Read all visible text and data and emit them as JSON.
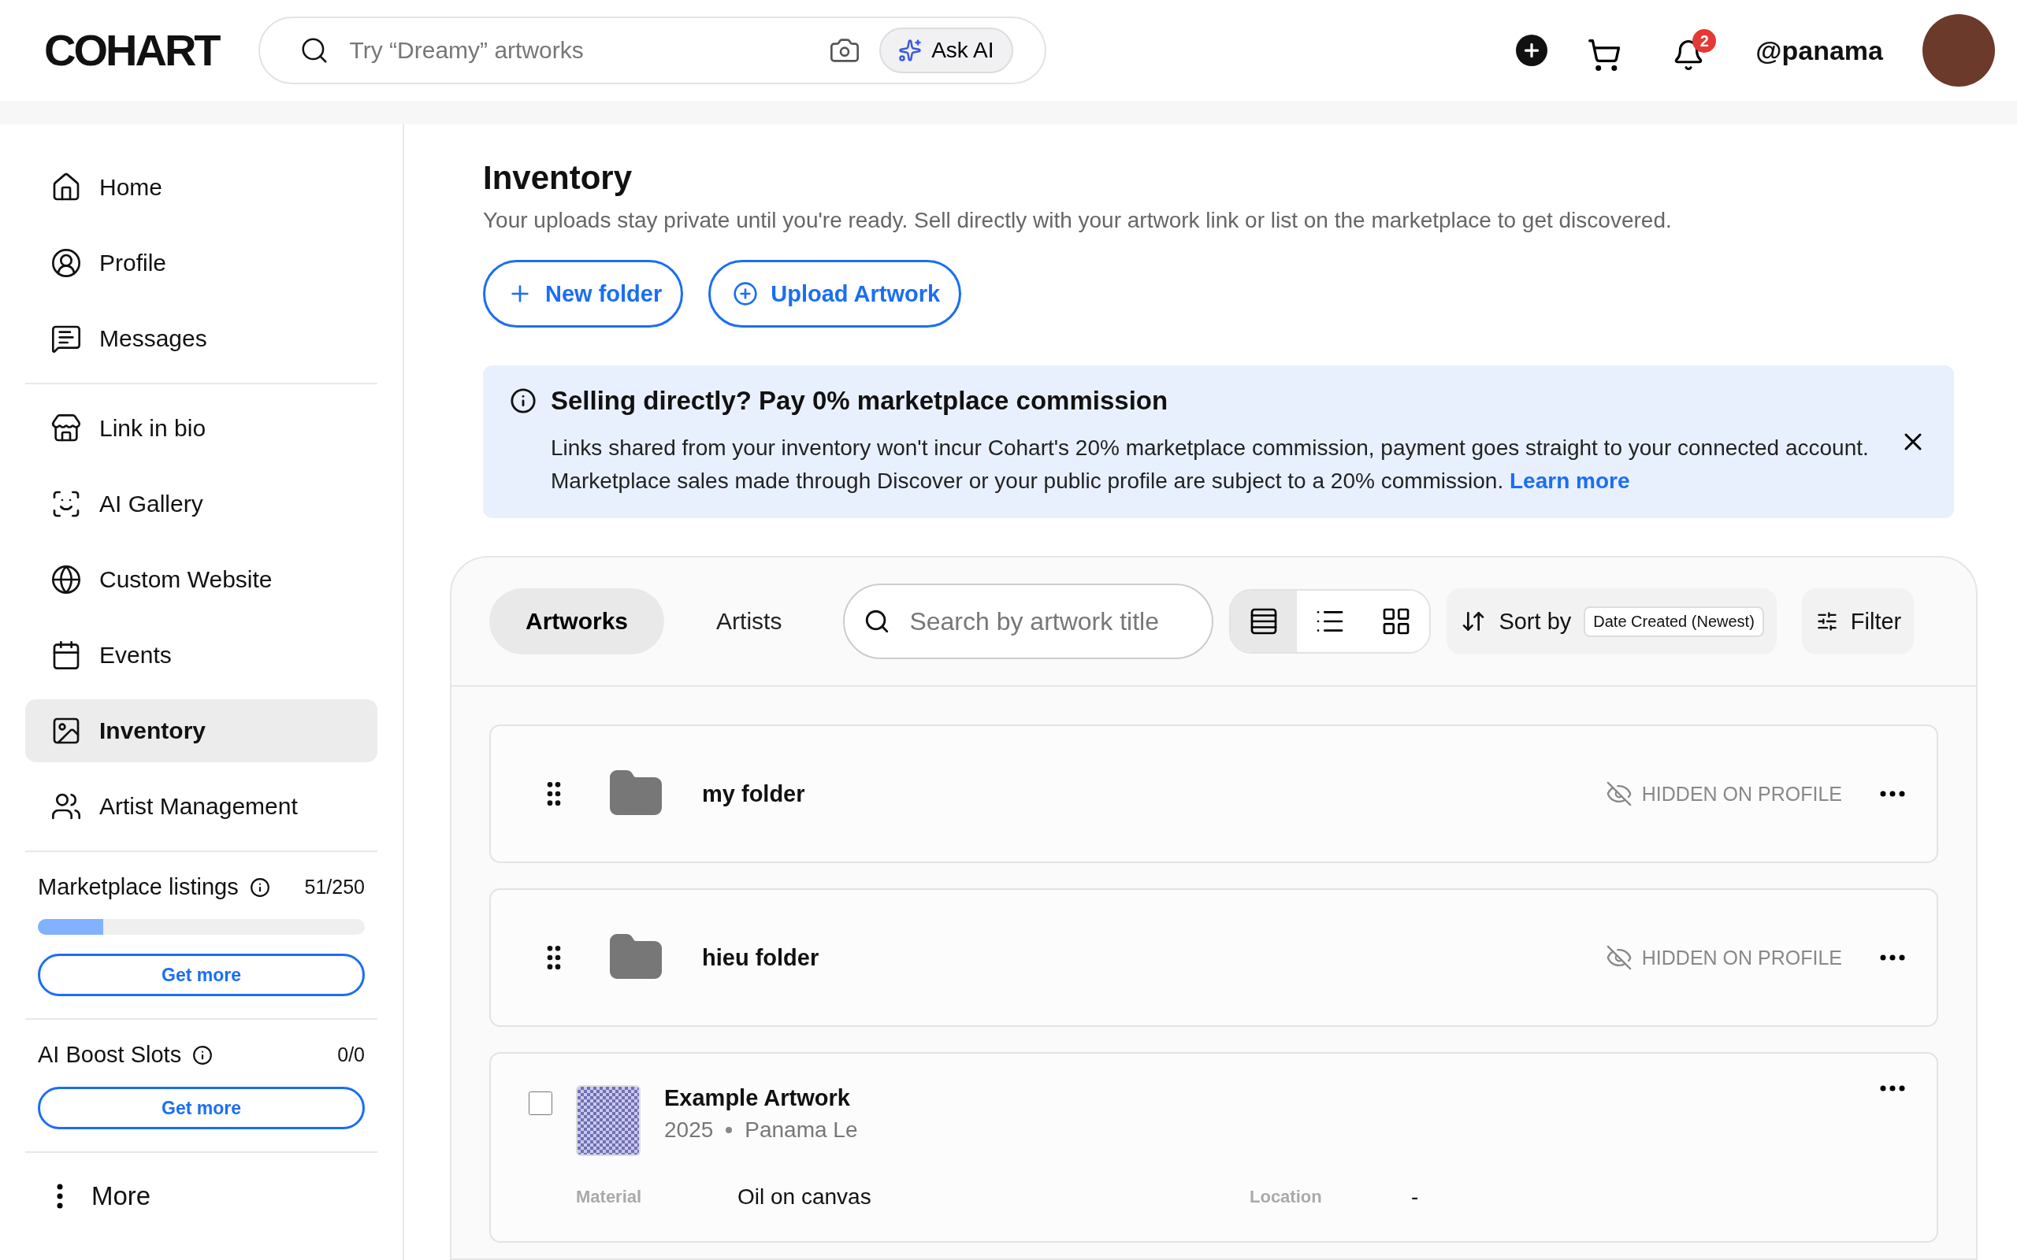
{
  "header": {
    "logo": "COHART",
    "search_placeholder": "Try “Dreamy” artworks",
    "ask_ai": "Ask AI",
    "notification_count": "2",
    "username": "@panama"
  },
  "sidebar": {
    "groups": [
      [
        {
          "label": "Home",
          "selected": false
        },
        {
          "label": "Profile",
          "selected": false
        },
        {
          "label": "Messages",
          "selected": false
        }
      ],
      [
        {
          "label": "Link in bio",
          "selected": false
        },
        {
          "label": "AI Gallery",
          "selected": false
        },
        {
          "label": "Custom Website",
          "selected": false
        },
        {
          "label": "Events",
          "selected": false
        },
        {
          "label": "Inventory",
          "selected": true
        },
        {
          "label": "Artist Management",
          "selected": false
        }
      ]
    ],
    "quotas": [
      {
        "label": "Marketplace listings",
        "count": "51/250",
        "level": 0.2,
        "button": "Get more"
      },
      {
        "label": "AI Boost Slots",
        "count": "0/0",
        "button": "Get more"
      }
    ],
    "more": "More"
  },
  "main": {
    "title": "Inventory",
    "description": "Your uploads stay private until you're ready. Sell directly with your artwork link or list on the marketplace to get discovered.",
    "actions": [
      "New folder",
      "Upload Artwork"
    ],
    "banner": {
      "title": "Selling directly? Pay 0% marketplace commission",
      "text": "Links shared from your inventory won't incur Cohart's 20% marketplace commission, payment goes straight to your connected account. Marketplace sales made through Discover or your public profile are subject to a 20% commission.",
      "link": "Learn more"
    },
    "toolbar": {
      "tabs": [
        {
          "label": "Artworks",
          "selected": true
        },
        {
          "label": "Artists",
          "selected": false
        }
      ],
      "search_placeholder": "Search by artwork title",
      "views": [
        {
          "selected": true
        },
        {
          "selected": false
        },
        {
          "selected": false
        }
      ],
      "sort_label": "Sort by",
      "sort_value": "Date Created (Newest)",
      "filter": "Filter"
    },
    "items": [
      {
        "kind": "folder",
        "name": "my folder",
        "status": "HIDDEN ON PROFILE"
      },
      {
        "kind": "folder",
        "name": "hieu folder",
        "status": "HIDDEN ON PROFILE"
      },
      {
        "kind": "artwork",
        "title": "Example Artwork",
        "year": "2025",
        "artist": "Panama Le",
        "checked": false,
        "fields": [
          {
            "label": "Material",
            "value": "Oil on canvas"
          },
          {
            "label": "Location",
            "value": "-"
          }
        ]
      }
    ]
  }
}
